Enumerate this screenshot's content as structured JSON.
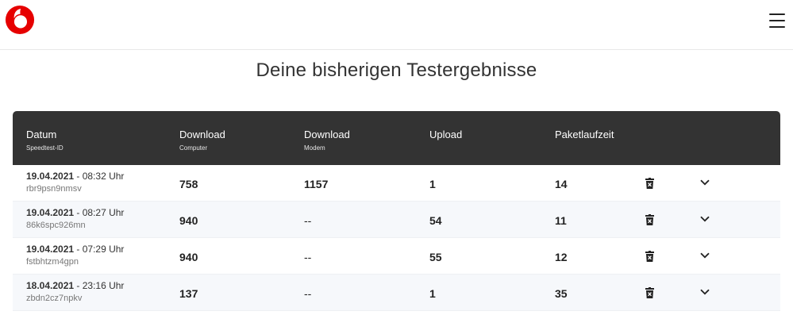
{
  "page": {
    "title": "Deine bisherigen Testergebnisse"
  },
  "colors": {
    "brand": "#e60000",
    "header_bg": "#333333",
    "row_alt_bg": "#f6f8fb"
  },
  "table": {
    "headers": [
      {
        "main": "Datum",
        "sub": "Speedtest-ID"
      },
      {
        "main": "Download",
        "sub": "Computer"
      },
      {
        "main": "Download",
        "sub": "Modem"
      },
      {
        "main": "Upload",
        "sub": ""
      },
      {
        "main": "Paketlaufzeit",
        "sub": ""
      }
    ],
    "rows": [
      {
        "date": "19.04.2021",
        "time": " - 08:32 Uhr",
        "id": "rbr9psn9nmsv",
        "download_computer": "758",
        "download_modem": "1157",
        "upload": "1",
        "latency": "14"
      },
      {
        "date": "19.04.2021",
        "time": " - 08:27 Uhr",
        "id": "86k6spc926mn",
        "download_computer": "940",
        "download_modem": "--",
        "upload": "54",
        "latency": "11"
      },
      {
        "date": "19.04.2021",
        "time": " - 07:29 Uhr",
        "id": "fstbhtzm4gpn",
        "download_computer": "940",
        "download_modem": "--",
        "upload": "55",
        "latency": "12"
      },
      {
        "date": "18.04.2021",
        "time": " - 23:16 Uhr",
        "id": "zbdn2cz7npkv",
        "download_computer": "137",
        "download_modem": "--",
        "upload": "1",
        "latency": "35"
      }
    ]
  },
  "icons": {
    "logo": "vodafone-logo",
    "menu": "hamburger-icon",
    "delete": "trash-icon",
    "expand": "chevron-down-icon"
  }
}
